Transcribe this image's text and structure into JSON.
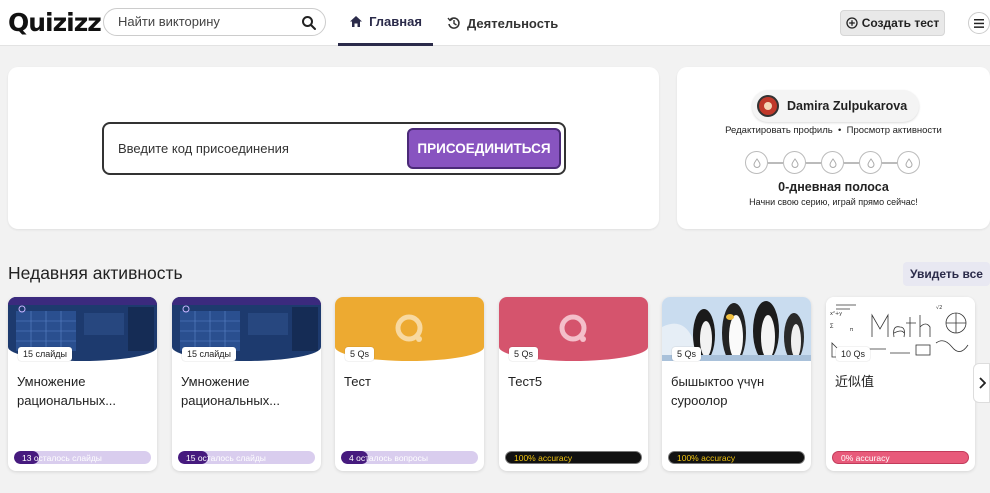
{
  "header": {
    "logo": "Quizizz",
    "search_placeholder": "Найти викторину",
    "tabs": [
      {
        "label": "Главная",
        "icon": "home-icon",
        "active": true
      },
      {
        "label": "Деятельность",
        "icon": "history-icon",
        "active": false
      }
    ],
    "create_label": "Создать тест"
  },
  "join": {
    "placeholder": "Введите код присоединения",
    "button_label": "ПРИСОЕДИНИТЬСЯ"
  },
  "profile": {
    "name": "Damira Zulpukarova",
    "edit_link": "Редактировать профиль",
    "separator": "•",
    "activity_link": "Просмотр активности",
    "streak_title": "0-дневная полоса",
    "streak_subtitle": "Начни свою серию, играй прямо сейчас!"
  },
  "recent": {
    "title": "Недавняя активность",
    "see_all": "Увидеть все",
    "cards": [
      {
        "count": "15 слайды",
        "title": "Умножение рациональных...",
        "progress_label": "13 осталось слайды",
        "progress": 0.18,
        "thumb": "lesson"
      },
      {
        "count": "15 слайды",
        "title": "Умножение рациональных...",
        "progress_label": "15 осталось слайды",
        "progress": 0.22,
        "thumb": "lesson"
      },
      {
        "count": "5 Qs",
        "title": "Тест",
        "progress_label": "4 осталось вопросы",
        "progress": 0.2,
        "thumb": "quiz-yellow"
      },
      {
        "count": "5 Qs",
        "title": "Тест5",
        "progress_label": "100% accuracy",
        "progress": 1.0,
        "thumb": "quiz-red"
      },
      {
        "count": "5 Qs",
        "title": "бышыктоо үчүн суроолор",
        "progress_label": "100% accuracy",
        "progress": 1.0,
        "thumb": "penguins"
      },
      {
        "count": "10 Qs",
        "title": "近似值",
        "progress_label": "0% accuracy",
        "progress": 0.0,
        "thumb": "math"
      }
    ]
  },
  "colors": {
    "accent_purple": "#8854c0",
    "quiz_yellow": "#edaa31",
    "quiz_red": "#d5546d"
  }
}
